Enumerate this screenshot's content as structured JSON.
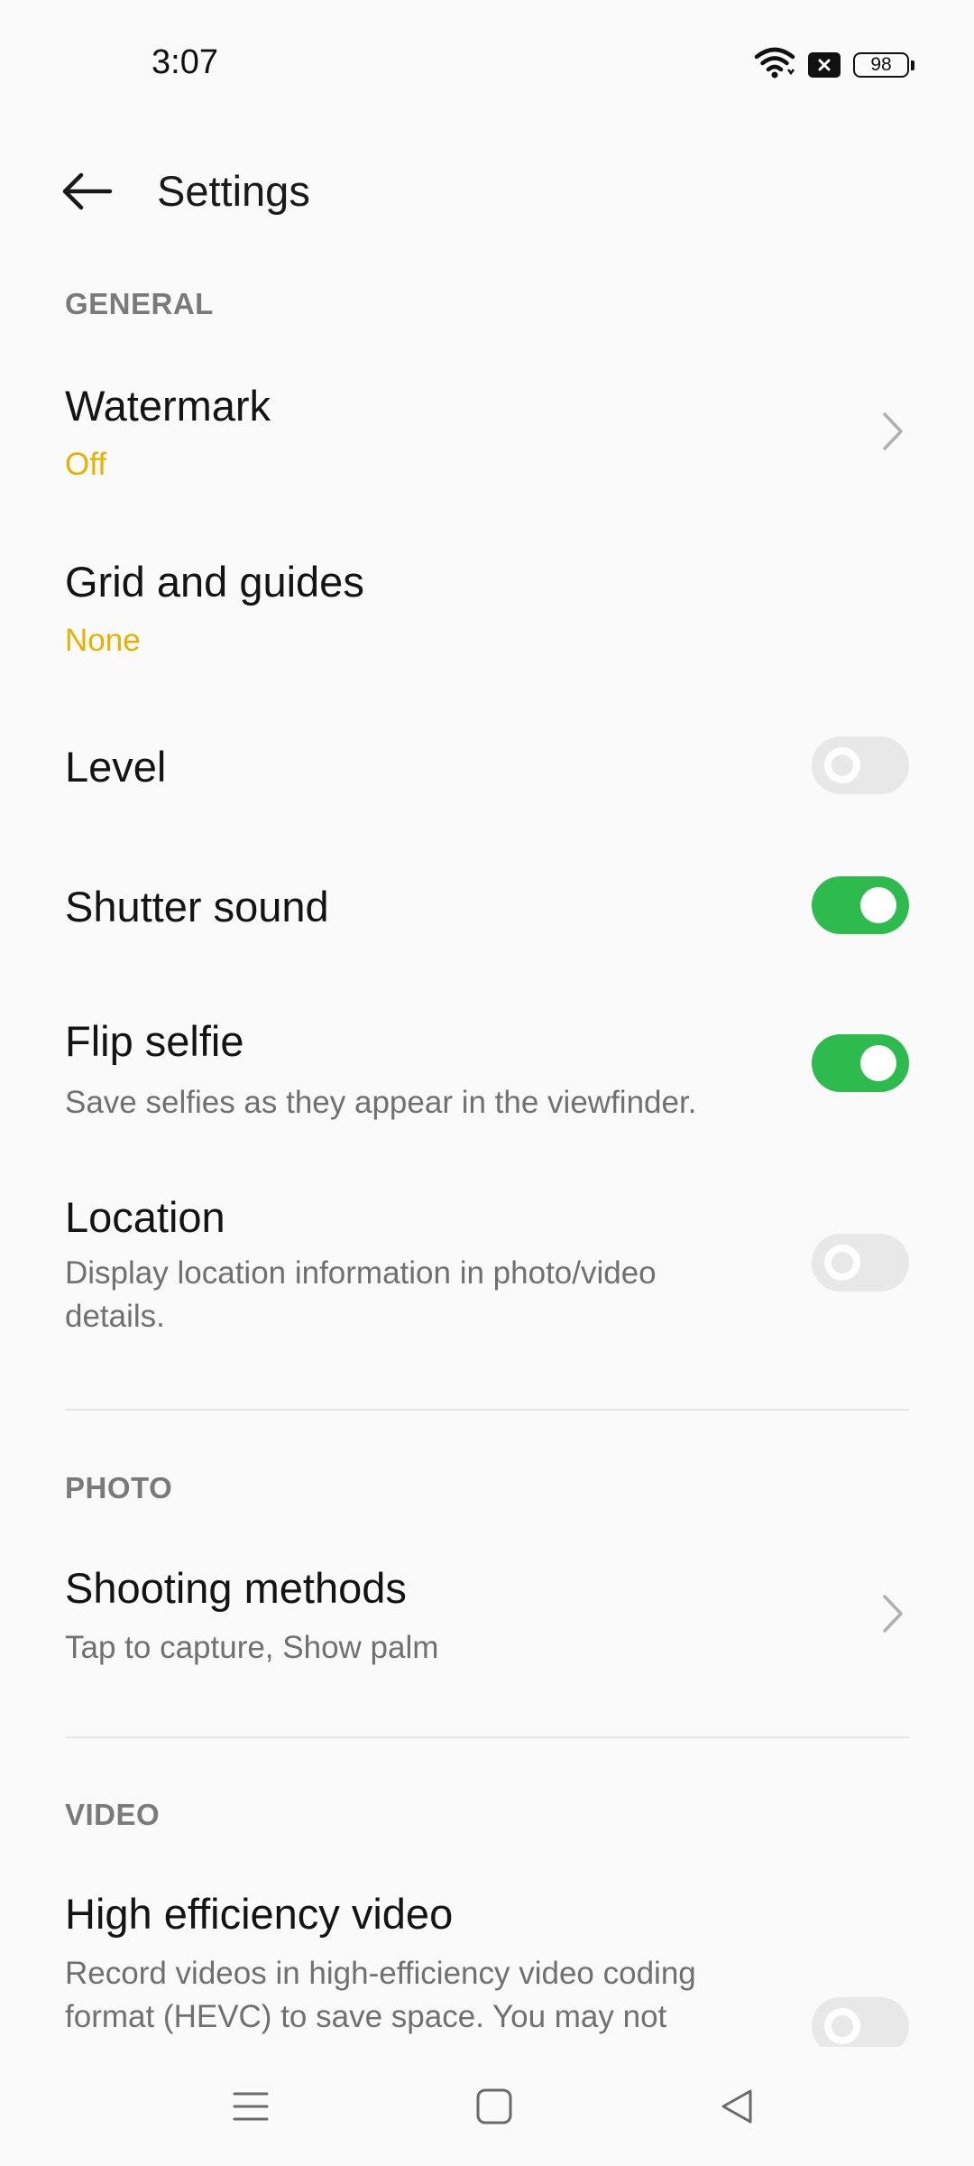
{
  "status_bar": {
    "time": "3:07",
    "battery_level": "98",
    "icons": [
      "wifi-icon",
      "notification-x-icon",
      "battery-icon"
    ]
  },
  "header": {
    "title": "Settings",
    "back_icon": "arrow-left-icon"
  },
  "sections": {
    "general": {
      "label": "GENERAL",
      "watermark": {
        "title": "Watermark",
        "value": "Off"
      },
      "grid": {
        "title": "Grid and guides",
        "value": "None"
      },
      "level": {
        "title": "Level",
        "enabled": false
      },
      "shutter_sound": {
        "title": "Shutter sound",
        "enabled": true
      },
      "flip_selfie": {
        "title": "Flip selfie",
        "description": "Save selfies as they appear in the viewfinder.",
        "enabled": true
      },
      "location": {
        "title": "Location",
        "description": "Display location information in photo/video details.",
        "enabled": false
      }
    },
    "photo": {
      "label": "PHOTO",
      "shooting_methods": {
        "title": "Shooting methods",
        "value": "Tap to capture, Show palm"
      }
    },
    "video": {
      "label": "VIDEO",
      "high_efficiency": {
        "title": "High efficiency video",
        "description": "Record videos in high-efficiency video coding format (HEVC) to save space. You may not",
        "enabled": false
      }
    }
  },
  "colors": {
    "accent_value": "#e8b100",
    "toggle_on": "#2dbb4e",
    "toggle_off": "#e8e8e8",
    "background": "#fafafa"
  },
  "nav_bar": {
    "icons": [
      "menu-icon",
      "home-icon",
      "back-triangle-icon"
    ]
  }
}
